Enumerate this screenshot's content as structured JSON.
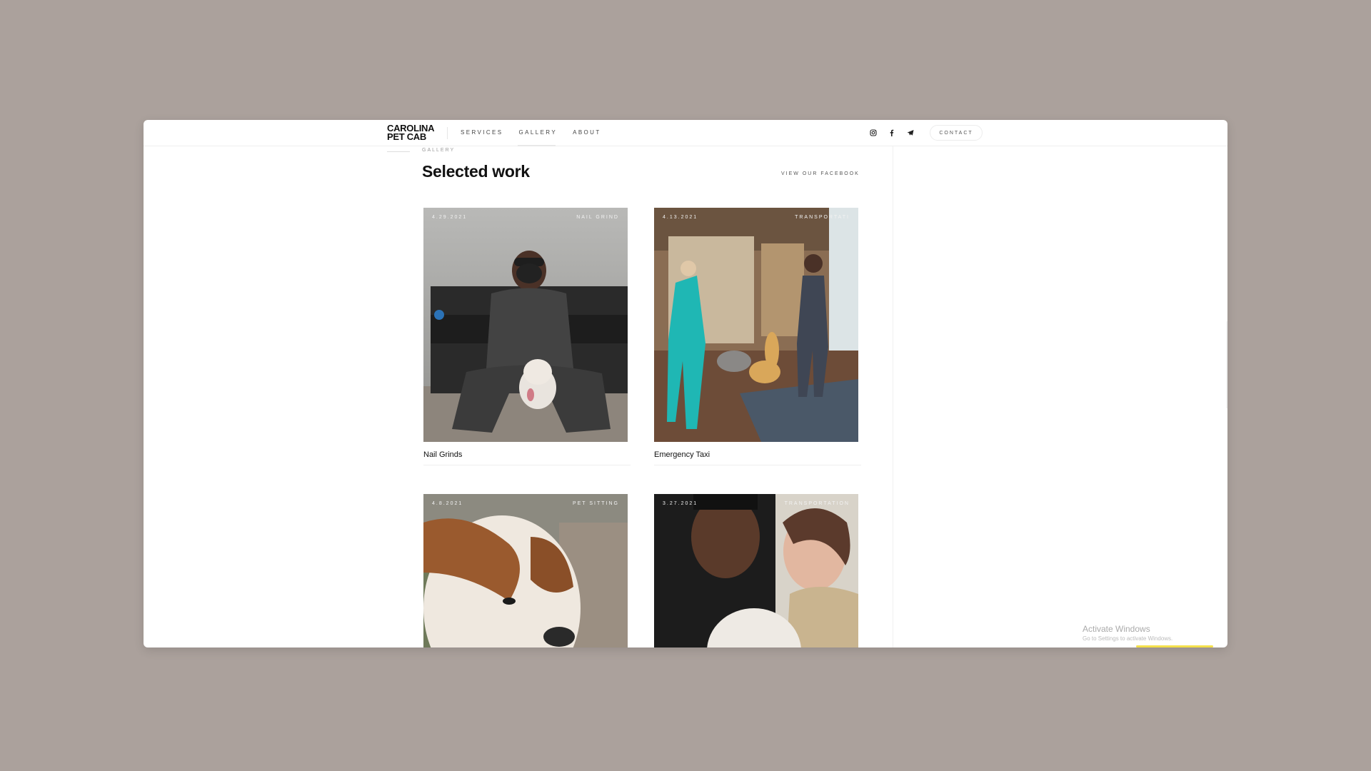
{
  "brand": {
    "line1": "CAROLINA",
    "line2": "PET CAB"
  },
  "nav": [
    {
      "label": "SERVICES",
      "active": false
    },
    {
      "label": "GALLERY",
      "active": true
    },
    {
      "label": "ABOUT",
      "active": false
    }
  ],
  "socials": [
    "instagram-icon",
    "facebook-icon",
    "telegram-icon"
  ],
  "contact_label": "CONTACT",
  "section": {
    "eyebrow": "GALLERY",
    "title": "Selected work",
    "facebook_link": "VIEW OUR FACEBOOK"
  },
  "cards": [
    {
      "date": "4.29.2021",
      "tag": "NAIL GRIND",
      "title": "Nail Grinds"
    },
    {
      "date": "4.13.2021",
      "tag": "TRANSPORTATI",
      "title": "Emergency Taxi"
    },
    {
      "date": "4.8.2021",
      "tag": "PET SITTING",
      "title": ""
    },
    {
      "date": "3.27.2021",
      "tag": "TRANSPORTATION",
      "title": ""
    }
  ],
  "watermark": {
    "title": "Activate Windows",
    "subtitle": "Go to Settings to activate Windows."
  },
  "colors": {
    "page_bg": "#aba19c",
    "window_bg": "#ffffff",
    "accent_yellow": "#f4e04b"
  }
}
